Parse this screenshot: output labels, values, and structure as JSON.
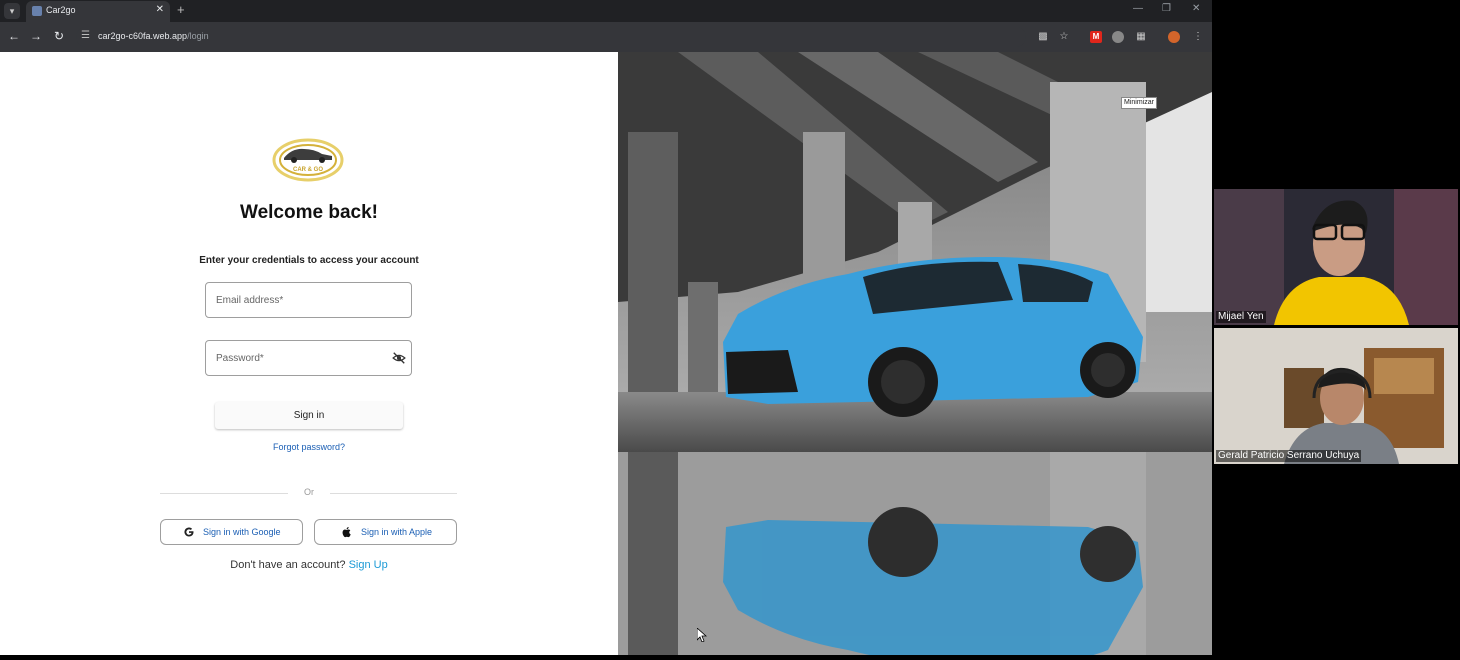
{
  "browser": {
    "tab_title": "Car2go",
    "url_host": "car2go-c60fa.web.app",
    "url_path": "/login",
    "tooltip": "Minimizar",
    "icons": [
      "tab-search-icon",
      "close-icon",
      "plus-icon",
      "minimize-icon",
      "maximize-icon",
      "close-icon",
      "back-arrow-icon",
      "forward-arrow-icon",
      "reload-icon",
      "site-info-icon",
      "translate-icon",
      "star-icon",
      "extension-icon",
      "extensions-puzzle-icon",
      "profile-avatar-icon",
      "more-vert-icon"
    ]
  },
  "login": {
    "logo_text": "CAR & GO",
    "title": "Welcome back!",
    "subtitle": "Enter your credentials to access your account",
    "email_placeholder": "Email address*",
    "password_placeholder": "Password*",
    "signin_label": "Sign in",
    "forgot_label": "Forgot password?",
    "divider_label": "Or",
    "google_label": "Sign in with Google",
    "apple_label": "Sign in with Apple",
    "no_account_text": "Don't have an account?",
    "signup_label": "Sign Up"
  },
  "colors": {
    "link": "#1b5fb4",
    "signup_link": "#1b9ad6",
    "car": "#3aa0dc",
    "logo_gold": "#d4b13a"
  },
  "participants": [
    {
      "name": "Mijael Yen"
    },
    {
      "name": "Gerald Patricio Serrano Uchuya"
    }
  ]
}
